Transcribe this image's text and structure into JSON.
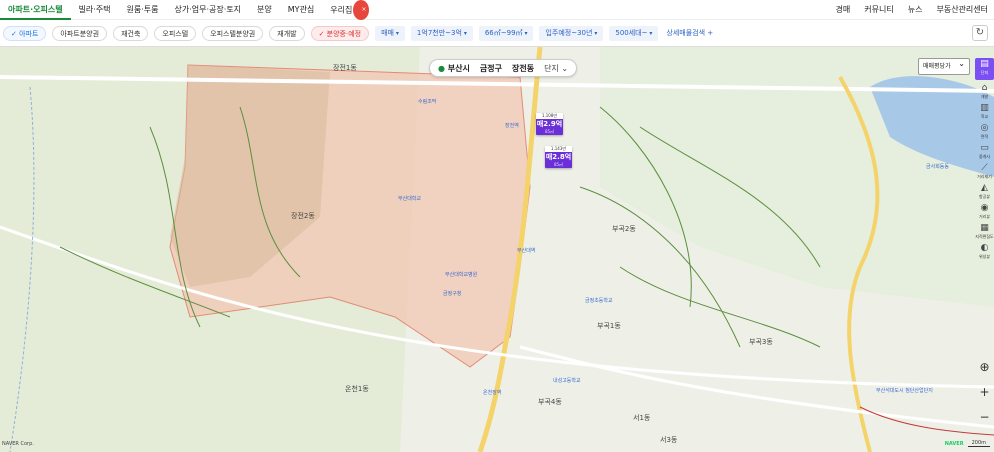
{
  "topnav": {
    "menu": [
      "아파트·오피스텔",
      "빌라·주택",
      "원룸·투룸",
      "상가·업무·공장·토지",
      "분양",
      "MY관심",
      "우리집"
    ],
    "right": [
      "경매",
      "커뮤니티",
      "뉴스",
      "부동산관리센터"
    ]
  },
  "filters": {
    "chips": [
      "아파트",
      "아파트분양권",
      "재건축",
      "오피스텔",
      "오피스텔분양권",
      "재개발",
      "분양중·예정"
    ],
    "selects": [
      "매매",
      "1억7천만~3억",
      "66㎡~99㎡",
      "입주예정~30년",
      "500세대~"
    ],
    "detail": "상세매물검색 +"
  },
  "location": {
    "city": "부산시",
    "district": "금정구",
    "dong": "장전동",
    "mode": "단지"
  },
  "trade_select": "매매평당가",
  "sidebar": [
    "단지",
    "개발",
    "학교",
    "면적",
    "중개사",
    "거리재기",
    "항공뷰",
    "거리뷰",
    "지적편집도",
    "위성뷰"
  ],
  "price_markers": [
    {
      "size": "1,108만",
      "price": "매2.9억",
      "area": "85㎡"
    },
    {
      "size": "1,143만",
      "price": "매2.8억",
      "area": "85㎡"
    }
  ],
  "labels": [
    "장전1동",
    "장전2동",
    "부곡2동",
    "부곡1동",
    "부곡4동",
    "서1동",
    "온천1동",
    "서3동",
    "부곡3동"
  ],
  "pois": [
    "수림조막",
    "부산대학교",
    "장전역",
    "부산대역",
    "온천장역",
    "금정구청",
    "부산대학교병원",
    "내성고등학교",
    "금정초등학교",
    "금사회동동",
    "부산석대도시 첨단산업단지"
  ],
  "footer": {
    "copyright": "NAVER Corp.",
    "scale": "200m",
    "logo": "NAVER"
  },
  "colors": {
    "brand": "#1a8a3a",
    "accent": "#6b2fd8",
    "region": "#f0c2ad"
  }
}
